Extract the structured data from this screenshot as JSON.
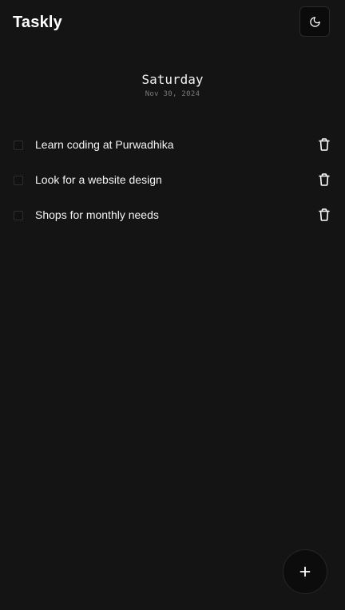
{
  "header": {
    "app_title": "Taskly",
    "theme_toggle_icon": "moon-icon"
  },
  "date": {
    "day": "Saturday",
    "full_date": "Nov 30, 2024"
  },
  "tasks": [
    {
      "label": "Learn coding at Purwadhika",
      "checked": false
    },
    {
      "label": "Look for a website design",
      "checked": false
    },
    {
      "label": "Shops for monthly needs",
      "checked": false
    }
  ],
  "icons": {
    "delete": "trash-icon",
    "add": "plus-icon"
  },
  "colors": {
    "background": "#141414",
    "text": "#ffffff",
    "muted": "#7a7a7a"
  }
}
